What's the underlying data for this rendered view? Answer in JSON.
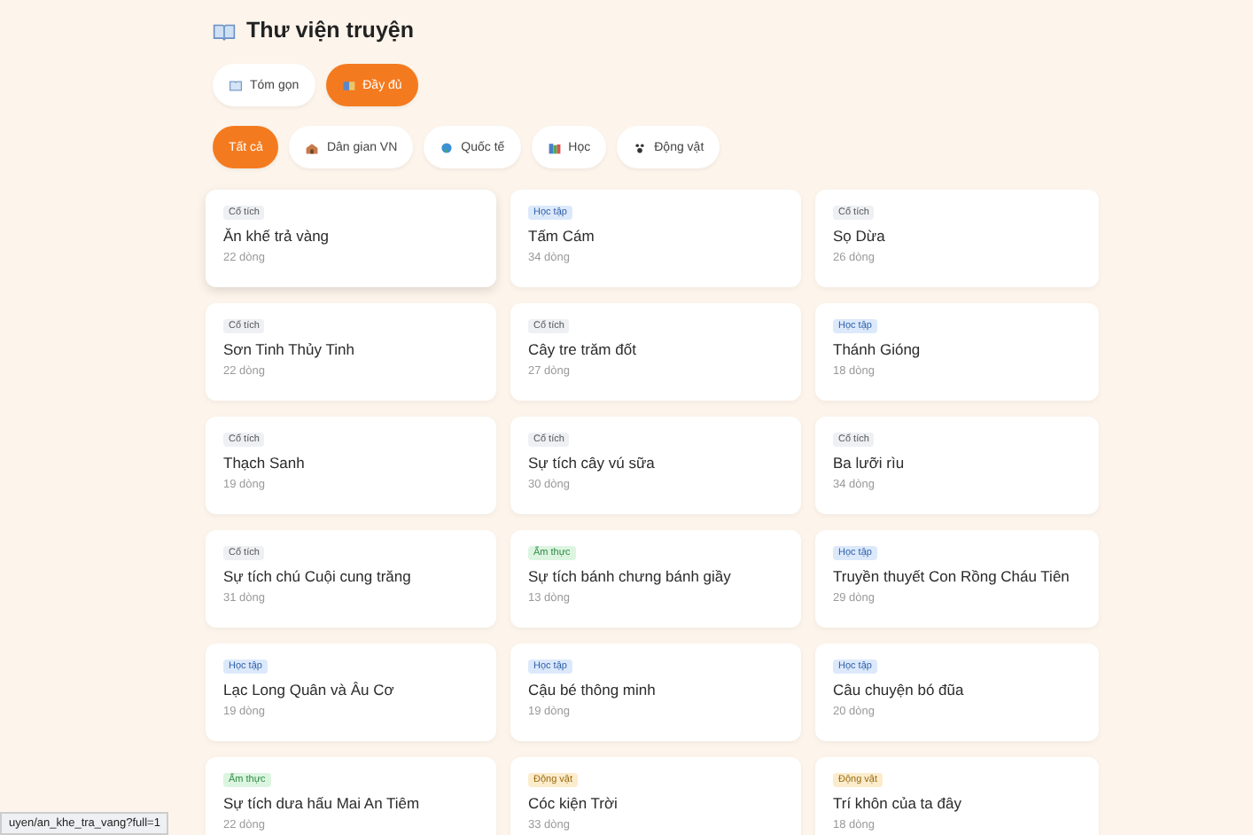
{
  "header": {
    "title": "Thư viện truyện"
  },
  "modes": [
    {
      "label": "Tóm gọn",
      "selected": false
    },
    {
      "label": "Đầy đủ",
      "selected": true
    }
  ],
  "filters": [
    {
      "label": "Tất cả",
      "selected": true,
      "kind": "all"
    },
    {
      "label": "Dân gian VN",
      "selected": false,
      "kind": "house"
    },
    {
      "label": "Quốc tế",
      "selected": false,
      "kind": "globe"
    },
    {
      "label": "Học",
      "selected": false,
      "kind": "books"
    },
    {
      "label": "Động vật",
      "selected": false,
      "kind": "paw"
    }
  ],
  "stories": [
    {
      "tag": "Cổ tích",
      "kind": "co_tich",
      "title": "Ăn khế trả vàng",
      "lines": "22 dòng"
    },
    {
      "tag": "Học tập",
      "kind": "hoc_tap",
      "title": "Tấm Cám",
      "lines": "34 dòng"
    },
    {
      "tag": "Cổ tích",
      "kind": "co_tich",
      "title": "Sọ Dừa",
      "lines": "26 dòng"
    },
    {
      "tag": "Cổ tích",
      "kind": "co_tich",
      "title": "Sơn Tinh Thủy Tinh",
      "lines": "22 dòng"
    },
    {
      "tag": "Cổ tích",
      "kind": "co_tich",
      "title": "Cây tre trăm đốt",
      "lines": "27 dòng"
    },
    {
      "tag": "Học tập",
      "kind": "hoc_tap",
      "title": "Thánh Gióng",
      "lines": "18 dòng"
    },
    {
      "tag": "Cổ tích",
      "kind": "co_tich",
      "title": "Thạch Sanh",
      "lines": "19 dòng"
    },
    {
      "tag": "Cổ tích",
      "kind": "co_tich",
      "title": "Sự tích cây vú sữa",
      "lines": "30 dòng"
    },
    {
      "tag": "Cổ tích",
      "kind": "co_tich",
      "title": "Ba lưỡi rìu",
      "lines": "34 dòng"
    },
    {
      "tag": "Cổ tích",
      "kind": "co_tich",
      "title": "Sự tích chú Cuội cung trăng",
      "lines": "31 dòng"
    },
    {
      "tag": "Ẩm thực",
      "kind": "am_thuc",
      "title": "Sự tích bánh chưng bánh giầy",
      "lines": "13 dòng"
    },
    {
      "tag": "Học tập",
      "kind": "hoc_tap",
      "title": "Truyền thuyết Con Rồng Cháu Tiên",
      "lines": "29 dòng"
    },
    {
      "tag": "Học tập",
      "kind": "hoc_tap",
      "title": "Lạc Long Quân và Âu Cơ",
      "lines": "19 dòng"
    },
    {
      "tag": "Học tập",
      "kind": "hoc_tap",
      "title": "Cậu bé thông minh",
      "lines": "19 dòng"
    },
    {
      "tag": "Học tập",
      "kind": "hoc_tap",
      "title": "Câu chuyện bó đũa",
      "lines": "20 dòng"
    },
    {
      "tag": "Ẩm thực",
      "kind": "am_thuc",
      "title": "Sự tích dưa hấu Mai An Tiêm",
      "lines": "22 dòng"
    },
    {
      "tag": "Động vật",
      "kind": "dong_vat",
      "title": "Cóc kiện Trời",
      "lines": "33 dòng"
    },
    {
      "tag": "Động vật",
      "kind": "dong_vat",
      "title": "Trí khôn của ta đây",
      "lines": "18 dòng"
    }
  ],
  "status_bar": {
    "url": "uyen/an_khe_tra_vang?full=1"
  }
}
